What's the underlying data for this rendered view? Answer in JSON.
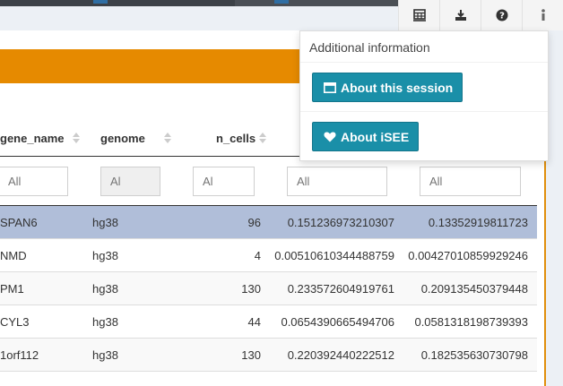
{
  "dropdown": {
    "header": "Additional information",
    "about_session_label": "About this session",
    "about_isee_label": "About iSEE"
  },
  "table": {
    "columns": [
      "gene_name",
      "genome",
      "n_cells"
    ],
    "filter_placeholder": "All",
    "filter_placeholder_short": "Al",
    "rows": [
      [
        "SPAN6",
        "hg38",
        "96",
        "0.151236973210307",
        "0.13352919811723"
      ],
      [
        "NMD",
        "hg38",
        "4",
        "0.00510610344488759",
        "0.00427010859929246"
      ],
      [
        "PM1",
        "hg38",
        "130",
        "0.233572604919761",
        "0.209135450379448"
      ],
      [
        "CYL3",
        "hg38",
        "44",
        "0.0654390665494706",
        "0.0581318198739393"
      ],
      [
        "1orf112",
        "hg38",
        "130",
        "0.220392440222512",
        "0.182535630730798"
      ]
    ],
    "selected_row": 0
  },
  "colors": {
    "orange": "#e68a00",
    "selected": "#b0bed9",
    "button": "#1a8fa8"
  },
  "icons": [
    "table-icon",
    "download-icon",
    "question-icon",
    "info-icon",
    "window-icon",
    "heart-icon",
    "sort-icon"
  ]
}
